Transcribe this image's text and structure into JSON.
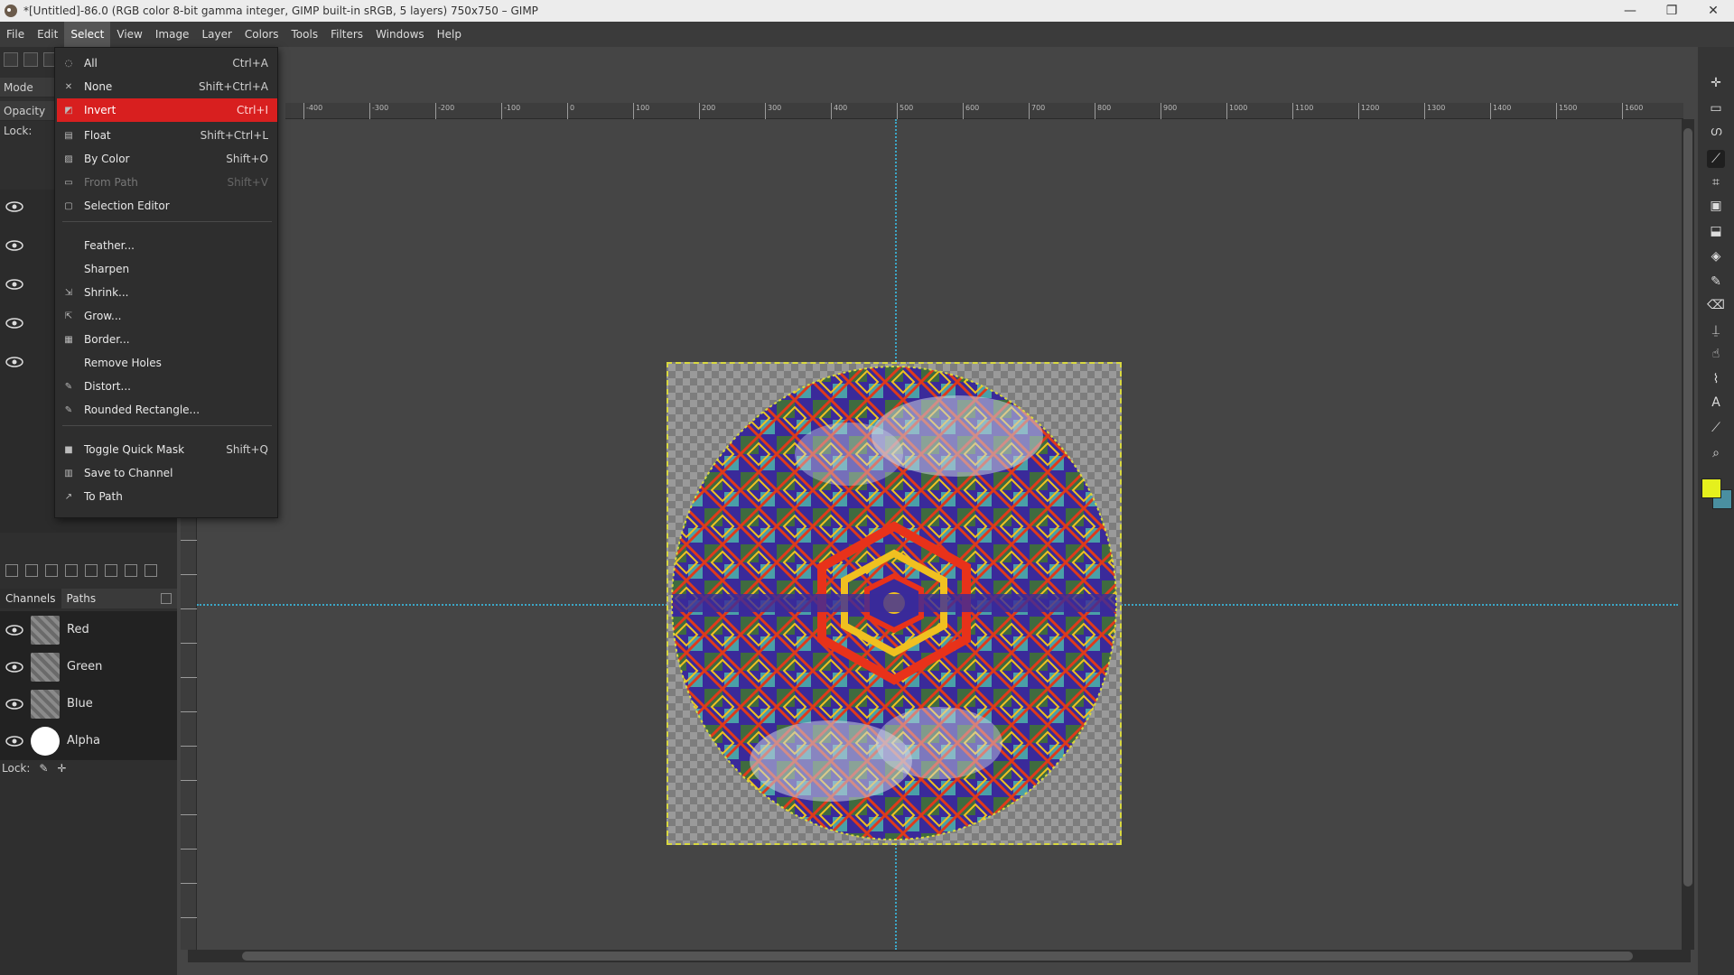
{
  "window": {
    "title": "*[Untitled]-86.0 (RGB color 8-bit gamma integer, GIMP built-in sRGB, 5 layers) 750x750 – GIMP",
    "minimize": "—",
    "maximize": "❐",
    "close": "✕"
  },
  "menubar": [
    "File",
    "Edit",
    "Select",
    "View",
    "Image",
    "Layer",
    "Colors",
    "Tools",
    "Filters",
    "Windows",
    "Help"
  ],
  "active_menu": "Select",
  "left_dock": {
    "mode_label": "Mode",
    "opacity_label": "Opacity",
    "lock_label": "Lock:",
    "lock_label_2": "Lock:"
  },
  "select_menu": {
    "items": [
      {
        "label": "All",
        "shortcut": "Ctrl+A",
        "icon": "◌"
      },
      {
        "label": "None",
        "shortcut": "Shift+Ctrl+A",
        "icon": "✕"
      },
      {
        "label": "Invert",
        "shortcut": "Ctrl+I",
        "icon": "◩",
        "highlighted": true
      },
      {
        "label": "Float",
        "shortcut": "Shift+Ctrl+L",
        "icon": "▤"
      },
      {
        "label": "By Color",
        "shortcut": "Shift+O",
        "icon": "▨"
      },
      {
        "label": "From Path",
        "shortcut": "Shift+V",
        "icon": "▭",
        "disabled": true
      },
      {
        "label": "Selection Editor",
        "shortcut": "",
        "icon": "▢"
      },
      {
        "label": "Feather...",
        "shortcut": "",
        "icon": ""
      },
      {
        "label": "Sharpen",
        "shortcut": "",
        "icon": ""
      },
      {
        "label": "Shrink...",
        "shortcut": "",
        "icon": "⇲"
      },
      {
        "label": "Grow...",
        "shortcut": "",
        "icon": "⇱"
      },
      {
        "label": "Border...",
        "shortcut": "",
        "icon": "▦"
      },
      {
        "label": "Remove Holes",
        "shortcut": "",
        "icon": ""
      },
      {
        "label": "Distort...",
        "shortcut": "",
        "icon": "✎"
      },
      {
        "label": "Rounded Rectangle...",
        "shortcut": "",
        "icon": "✎"
      },
      {
        "label": "Toggle Quick Mask",
        "shortcut": "Shift+Q",
        "icon": "■"
      },
      {
        "label": "Save to Channel",
        "shortcut": "",
        "icon": "▥"
      },
      {
        "label": "To Path",
        "shortcut": "",
        "icon": "↗"
      }
    ]
  },
  "channels_panel": {
    "tabs": [
      "Channels",
      "Paths"
    ],
    "channels": [
      "Red",
      "Green",
      "Blue",
      "Alpha"
    ]
  },
  "ruler_labels": [
    "-400",
    "-300",
    "-200",
    "-100",
    "0",
    "100",
    "200",
    "300",
    "400",
    "500",
    "600",
    "700",
    "800",
    "900",
    "1000",
    "1100",
    "1200",
    "1300",
    "1400",
    "1500",
    "1600"
  ],
  "colors": {
    "menu_highlight": "#d81f1f",
    "foreground": "#e5f01d",
    "background": "#4a8fa0",
    "guide": "#3ba7c7"
  }
}
